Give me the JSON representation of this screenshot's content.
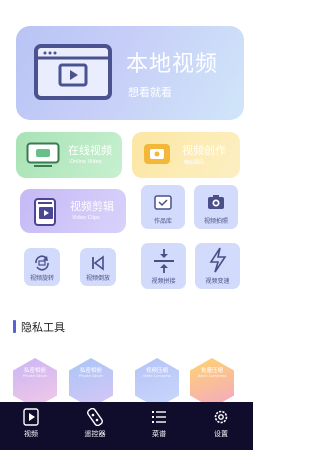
{
  "hero": {
    "title": "本地视频",
    "subtitle": "想看就看"
  },
  "online": {
    "title": "在线视频",
    "subtitle": "Online Video"
  },
  "create": {
    "title": "视频创作",
    "subtitle": "精彩瞬间"
  },
  "clip": {
    "title": "视频剪辑",
    "subtitle": "Video Clips"
  },
  "tiles": {
    "works": "作品库",
    "capture": "视频拍照",
    "rotate": "视频旋转",
    "reverse": "视频倒放",
    "splice": "视频拼接",
    "speed": "视频变速"
  },
  "section": {
    "title": "隐私工具"
  },
  "privacy": [
    {
      "label": "私密相册",
      "sub": "Private Album"
    },
    {
      "label": "私密相册",
      "sub": "Private Album"
    },
    {
      "label": "视频压缩",
      "sub": "Video Compress"
    },
    {
      "label": "批量压缩",
      "sub": "Batch Compress"
    }
  ],
  "nav": [
    {
      "label": "视频"
    },
    {
      "label": "遥控器"
    },
    {
      "label": "菜谱"
    },
    {
      "label": "设置"
    }
  ],
  "colors": {
    "accent": "#5b5fd9",
    "nav_bg": "#0f0d2b"
  }
}
